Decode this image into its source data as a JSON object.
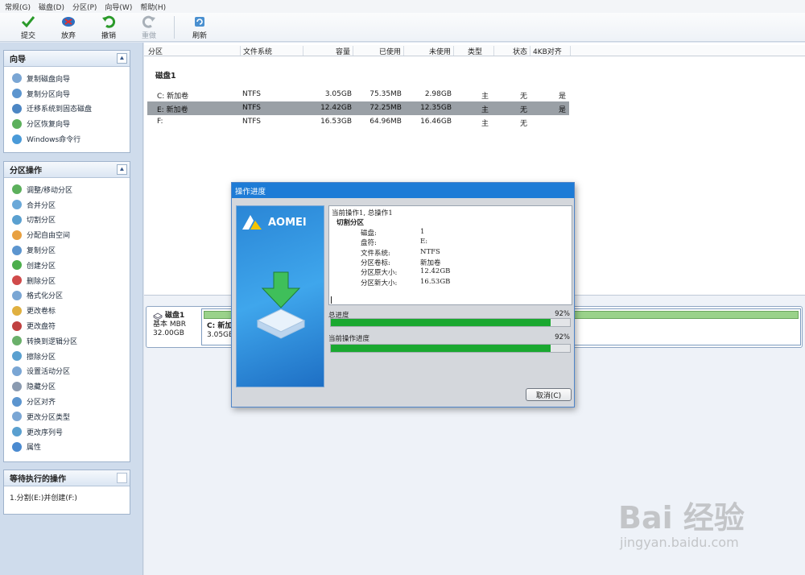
{
  "menubar": [
    "常规(G)",
    "磁盘(D)",
    "分区(P)",
    "向导(W)",
    "帮助(H)"
  ],
  "toolbar": {
    "commit": "提交",
    "discard": "放弃",
    "undo": "撤销",
    "redo": "重做",
    "refresh": "刷新"
  },
  "wizard_panel": {
    "title": "向导",
    "items": [
      "复制磁盘向导",
      "复制分区向导",
      "迁移系统到固态磁盘",
      "分区恢复向导",
      "Windows命令行"
    ]
  },
  "ops_panel": {
    "title": "分区操作",
    "items": [
      "调整/移动分区",
      "合并分区",
      "切割分区",
      "分配自由空间",
      "复制分区",
      "创建分区",
      "删除分区",
      "格式化分区",
      "更改卷标",
      "更改盘符",
      "转换到逻辑分区",
      "擦除分区",
      "设置活动分区",
      "隐藏分区",
      "分区对齐",
      "更改分区类型",
      "更改序列号",
      "属性"
    ]
  },
  "pending_panel": {
    "title": "等待执行的操作",
    "items": [
      "1.分割(E:)并创建(F:)"
    ]
  },
  "table": {
    "headers": [
      "分区",
      "文件系统",
      "容量",
      "已使用",
      "未使用",
      "类型",
      "状态",
      "4KB对齐"
    ],
    "disk_label": "磁盘1",
    "rows": [
      {
        "name": "C: 新加卷",
        "fs": "NTFS",
        "cap": "3.05GB",
        "used": "75.35MB",
        "free": "2.98GB",
        "type": "主",
        "status": "无",
        "align": "是"
      },
      {
        "name": "E: 新加卷",
        "fs": "NTFS",
        "cap": "12.42GB",
        "used": "72.25MB",
        "free": "12.35GB",
        "type": "主",
        "status": "无",
        "align": "是"
      },
      {
        "name": "F:",
        "fs": "NTFS",
        "cap": "16.53GB",
        "used": "64.96MB",
        "free": "16.46GB",
        "type": "主",
        "status": "无",
        "align": ""
      }
    ]
  },
  "disk_map": {
    "name": "磁盘1",
    "type": "基本 MBR",
    "size": "32.00GB",
    "part_label": "C: 新加",
    "part_size": "3.05GB"
  },
  "dialog": {
    "title": "操作进度",
    "brand": "AOMEI",
    "log_header": "当前操作1, 总操作1",
    "log_op": "切割分区",
    "log_kv": [
      {
        "k": "磁盘:",
        "v": "1"
      },
      {
        "k": "盘符:",
        "v": "E:"
      },
      {
        "k": "文件系统:",
        "v": "NTFS"
      },
      {
        "k": "分区卷标:",
        "v": "新加卷"
      },
      {
        "k": "分区原大小:",
        "v": "12.42GB"
      },
      {
        "k": "分区新大小:",
        "v": "16.53GB"
      }
    ],
    "total_label": "总进度",
    "total_pct": "92%",
    "total_value": 92,
    "current_label": "当前操作进度",
    "current_pct": "92%",
    "current_value": 92,
    "cancel": "取消(C)"
  },
  "watermark": {
    "main": "Bai 经验",
    "sub": "jingyan.baidu.com"
  },
  "colors": {
    "accent": "#1d7bd6",
    "progress": "#1aa830",
    "selection": "#9aa0a6"
  }
}
